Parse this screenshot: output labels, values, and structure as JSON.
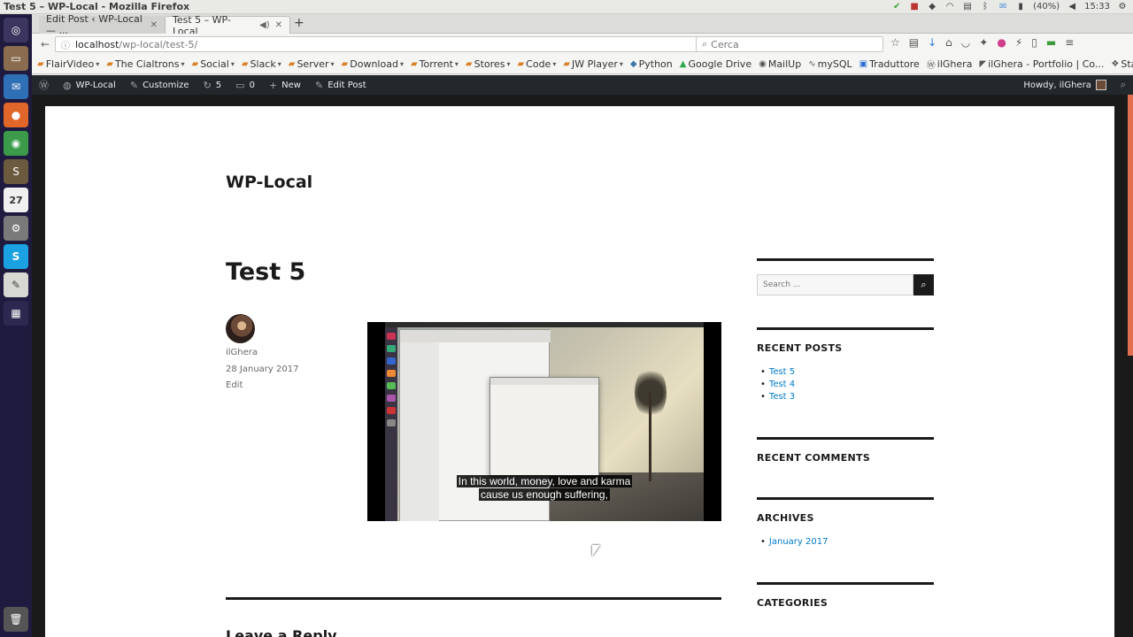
{
  "window": {
    "title": "Test 5 – WP-Local - Mozilla Firefox"
  },
  "tray": {
    "battery": "(40%)",
    "time": "15:33"
  },
  "launcher": {
    "calendar_day": "27"
  },
  "tabs": [
    {
      "label": "Edit Post ‹ WP-Local — ..."
    },
    {
      "label": "Test 5 – WP-Local"
    }
  ],
  "urlbar": {
    "host": "localhost",
    "path": "/wp-local/test-5/"
  },
  "searchbar": {
    "placeholder": "Cerca"
  },
  "bookmarks": [
    {
      "label": "FlairVideo",
      "type": "folder"
    },
    {
      "label": "The Cialtrons",
      "type": "folder"
    },
    {
      "label": "Social",
      "type": "folder"
    },
    {
      "label": "Slack",
      "type": "folder"
    },
    {
      "label": "Server",
      "type": "folder"
    },
    {
      "label": "Download",
      "type": "folder"
    },
    {
      "label": "Torrent",
      "type": "folder"
    },
    {
      "label": "Stores",
      "type": "folder"
    },
    {
      "label": "Code",
      "type": "folder"
    },
    {
      "label": "JW Player",
      "type": "folder"
    },
    {
      "label": "Python",
      "type": "link"
    },
    {
      "label": "Google Drive",
      "type": "link"
    },
    {
      "label": "MailUp",
      "type": "link"
    },
    {
      "label": "mySQL",
      "type": "link"
    },
    {
      "label": "Traduttore",
      "type": "link"
    },
    {
      "label": "ilGhera",
      "type": "link"
    },
    {
      "label": "ilGhera - Portfolio | Co...",
      "type": "link"
    },
    {
      "label": "Stack Overflow",
      "type": "link"
    }
  ],
  "adminbar": {
    "site": "WP-Local",
    "customize": "Customize",
    "updates": "5",
    "comments": "0",
    "new": "New",
    "edit_post": "Edit Post",
    "howdy": "Howdy, ilGhera"
  },
  "site": {
    "title": "WP-Local"
  },
  "post": {
    "title": "Test 5",
    "author": "ilGhera",
    "date": "28 January 2017",
    "edit": "Edit",
    "caption_line1": "In this world, money, love and karma",
    "caption_line2": "cause us enough suffering,"
  },
  "sidebar": {
    "search_placeholder": "Search ...",
    "recent_posts_title": "RECENT POSTS",
    "recent_posts": [
      "Test 5",
      "Test 4",
      "Test 3"
    ],
    "recent_comments_title": "RECENT COMMENTS",
    "archives_title": "ARCHIVES",
    "archives": [
      "January 2017"
    ],
    "categories_title": "CATEGORIES"
  },
  "comments": {
    "title": "Leave a Reply"
  },
  "colors": {
    "link": "#007acc",
    "adminbar": "#23282d",
    "scroll_accent": "#e07050",
    "folder": "#d9822b"
  }
}
